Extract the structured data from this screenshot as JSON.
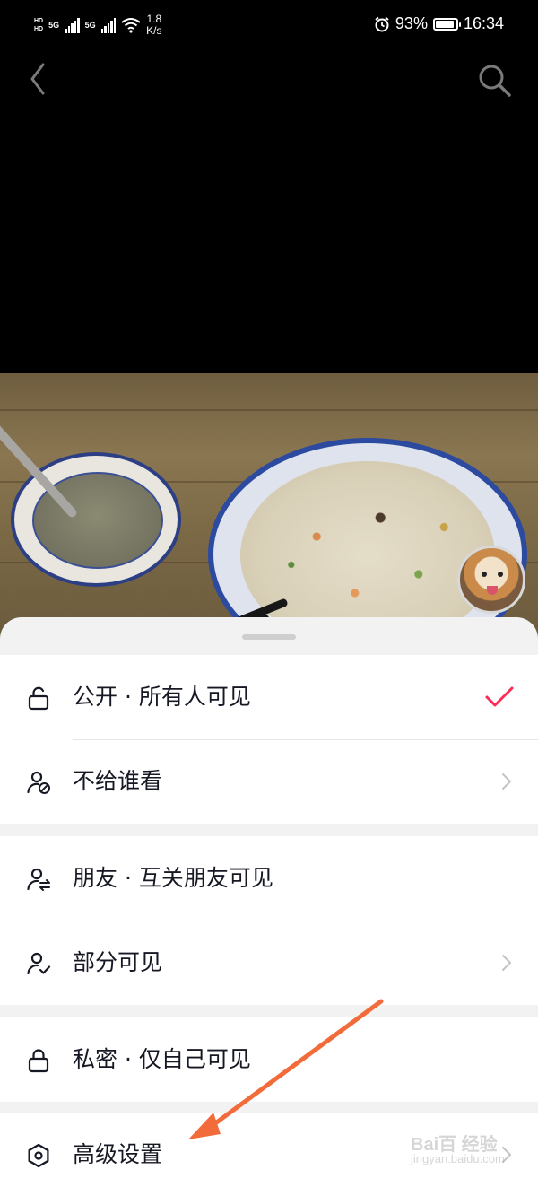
{
  "status_bar": {
    "hd_top": "HD",
    "hd_bottom": "HD",
    "net_1": "5G",
    "net_2": "5G",
    "speed_value": "1.8",
    "speed_unit": "K/s",
    "battery": "93%",
    "battery_level": 0.93,
    "time": "16:34"
  },
  "nav": {
    "back_icon": "chevron-left-icon",
    "search_icon": "search-icon"
  },
  "colors": {
    "accent_check": "#fe2c55",
    "annotation_arrow": "#f26b3a",
    "sheet_bg": "#f2f2f2",
    "row_bg": "#ffffff"
  },
  "sheet": {
    "groups": [
      {
        "items": [
          {
            "label": "公开 · 所有人可见",
            "icon": "unlock-icon",
            "trailing": "check-icon",
            "selected": true
          },
          {
            "label": "不给谁看",
            "icon": "user-block-icon",
            "trailing": "chevron-right-icon"
          }
        ]
      },
      {
        "items": [
          {
            "label": "朋友 · 互关朋友可见",
            "icon": "user-swap-icon",
            "trailing": "none"
          },
          {
            "label": "部分可见",
            "icon": "user-check-icon",
            "trailing": "chevron-right-icon"
          }
        ]
      },
      {
        "items": [
          {
            "label": "私密 · 仅自己可见",
            "icon": "lock-icon",
            "trailing": "none"
          }
        ]
      },
      {
        "items": [
          {
            "label": "高级设置",
            "icon": "hexagon-settings-icon",
            "trailing": "chevron-right-icon"
          }
        ]
      }
    ]
  },
  "watermark": {
    "brand": "Bai百 经验",
    "url": "jingyan.baidu.com"
  }
}
